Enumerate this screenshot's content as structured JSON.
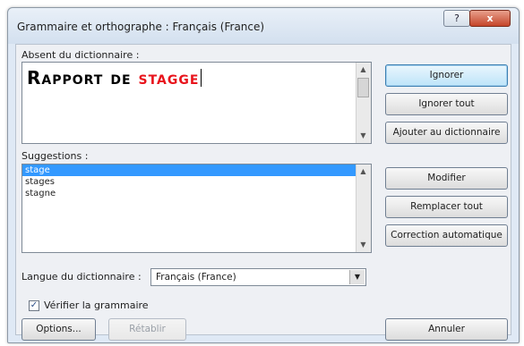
{
  "window": {
    "title": "Grammaire et orthographe : Français (France)",
    "help_label": "?",
    "close_label": "x"
  },
  "not_found": {
    "label": "Absent du dictionnaire :",
    "text_black": "Rapport de ",
    "text_red": "stagge"
  },
  "suggestions": {
    "label": "Suggestions :",
    "items": [
      {
        "text": "stage",
        "selected": true
      },
      {
        "text": "stages",
        "selected": false
      },
      {
        "text": "stagne",
        "selected": false
      }
    ]
  },
  "buttons": {
    "ignore": "Ignorer",
    "ignore_all": "Ignorer tout",
    "add_to_dictionary": "Ajouter au dictionnaire",
    "change": "Modifier",
    "change_all": "Remplacer tout",
    "autocorrect": "Correction automatique",
    "options": "Options...",
    "undo": "Rétablir",
    "cancel": "Annuler"
  },
  "language": {
    "label": "Langue du dictionnaire :",
    "value": "Français (France)"
  },
  "check_grammar": {
    "label": "Vérifier la grammaire",
    "checked": true,
    "check_glyph": "✓"
  },
  "colors": {
    "error_text": "#e8141c",
    "selection": "#3399ff",
    "dialog_bg": "#dfe9f5"
  }
}
